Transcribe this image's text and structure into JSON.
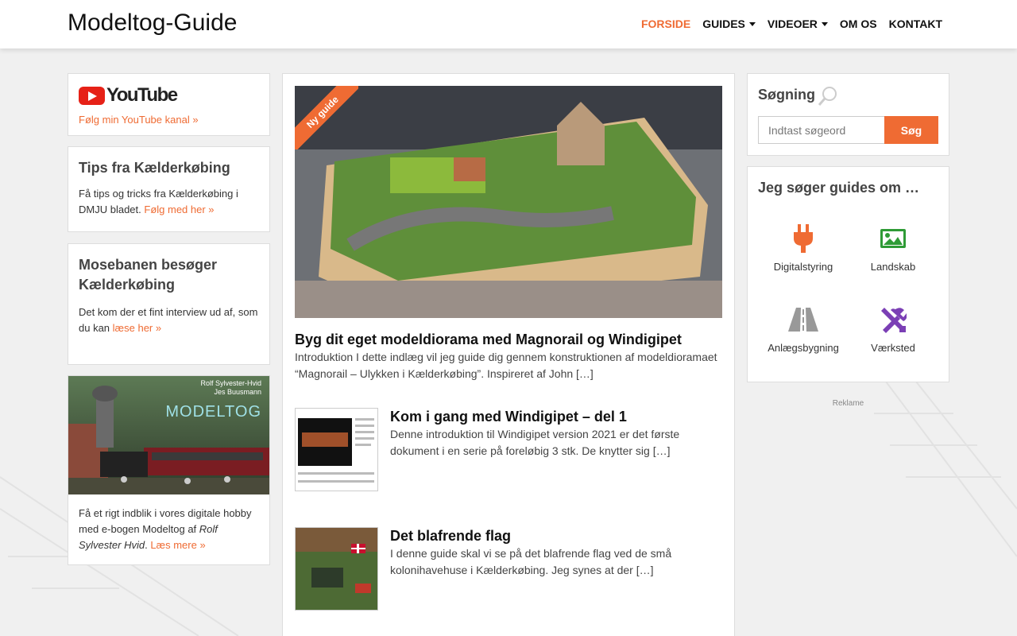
{
  "header": {
    "site_title": "Modeltog-Guide",
    "nav": [
      {
        "label": "FORSIDE",
        "active": true,
        "dropdown": false
      },
      {
        "label": "GUIDES",
        "active": false,
        "dropdown": true
      },
      {
        "label": "VIDEOER",
        "active": false,
        "dropdown": true
      },
      {
        "label": "OM OS",
        "active": false,
        "dropdown": false
      },
      {
        "label": "KONTAKT",
        "active": false,
        "dropdown": false
      }
    ]
  },
  "colors": {
    "accent": "#ef6b33",
    "purple": "#7b3fb5",
    "green": "#2f9b36",
    "gray": "#888888"
  },
  "left": {
    "youtube": {
      "logo_text": "YouTube",
      "link": "Følg min YouTube kanal »"
    },
    "tips": {
      "title": "Tips fra Kælderkøbing",
      "text": "Få tips og tricks fra Kælderkøbing i DMJU bladet.",
      "link": "Følg med her »"
    },
    "mose": {
      "title": "Mosebanen besøger Kælderkøbing",
      "text": "Det kom der et fint interview ud af, som du kan",
      "link": "læse her »"
    },
    "ebook": {
      "cover_authors_1": "Rolf Sylvester-Hvid",
      "cover_authors_2": "Jes Buusmann",
      "cover_title": "MODELTOG",
      "text": "Få et rigt indblik i vores digitale hobby med e-bogen Modeltog af",
      "author": "Rolf Sylvester Hvid",
      "link": "Læs mere »"
    }
  },
  "main": {
    "featured": {
      "ribbon": "Ny guide",
      "title": "Byg dit eget modeldiorama med Magnorail og Windigipet",
      "excerpt": "Introduktion I dette indlæg vil jeg guide dig gennem konstruktionen af modeldioramaet “Magnorail – Ulykken i Kælderkøbing”. Inspireret af John […]"
    },
    "posts": [
      {
        "title": "Kom i gang med Windigipet – del 1",
        "excerpt": "Denne introduktion til Windigipet version 2021 er det første dokument i en serie på foreløbig 3 stk. De knytter sig […]"
      },
      {
        "title": "Det blafrende flag",
        "excerpt": "I denne guide skal vi se på det blafrende flag ved de små kolonihavehuse i Kælderkøbing. Jeg synes at der […]"
      }
    ]
  },
  "right": {
    "search": {
      "title": "Søgning",
      "placeholder": "Indtast søgeord",
      "button": "Søg"
    },
    "categories_title": "Jeg søger guides om …",
    "categories": [
      {
        "label": "Digitalstyring",
        "icon": "plug-icon"
      },
      {
        "label": "Landskab",
        "icon": "image-icon"
      },
      {
        "label": "Anlægsbygning",
        "icon": "road-icon"
      },
      {
        "label": "Værksted",
        "icon": "tools-icon"
      }
    ],
    "ad_label": "Reklame"
  }
}
